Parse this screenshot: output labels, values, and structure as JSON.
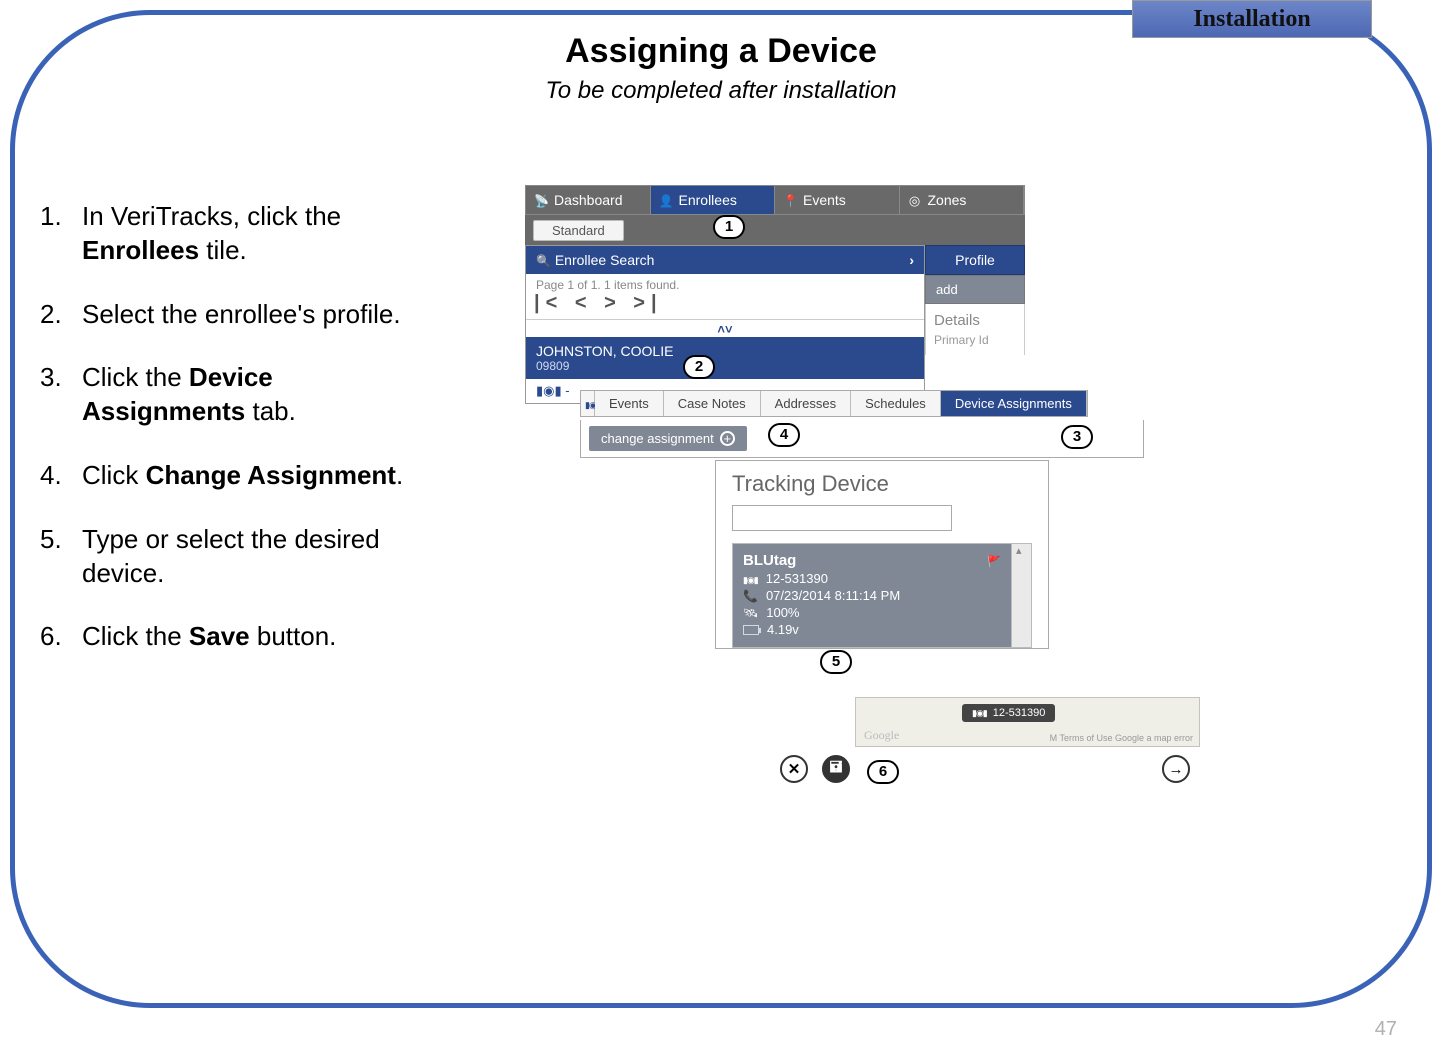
{
  "topTab": "Installation",
  "pageNumber": "47",
  "heading": "Assigning a Device",
  "subtitle": "To be completed after installation",
  "steps": {
    "s1_pre": "In VeriTracks, click the ",
    "s1_b": "Enrollees",
    "s1_post": " tile.",
    "s2": "Select the enrollee's profile.",
    "s3_pre": "Click the ",
    "s3_b": "Device Assignments",
    "s3_post": " tab.",
    "s4_pre": "Click ",
    "s4_b": "Change Assignment",
    "s4_post": ".",
    "s5": "Type or select the desired device.",
    "s6_pre": "Click the ",
    "s6_b": "Save",
    "s6_post": " button."
  },
  "callouts": {
    "c1": "1",
    "c2": "2",
    "c3": "3",
    "c4": "4",
    "c5": "5",
    "c6": "6"
  },
  "nav": {
    "dashboard": "Dashboard",
    "enrollees": "Enrollees",
    "events": "Events",
    "zones": "Zones",
    "standard": "Standard"
  },
  "search": {
    "title": "Enrollee Search",
    "pageInfo": "Page 1 of 1. 1 items found.",
    "pager": "|<  <  >  >|",
    "sort": "˄˅",
    "enrolleeName": "JOHNSTON, COOLIE",
    "enrolleeId": "09809",
    "footIcon": "▮◉▮ -"
  },
  "profile": {
    "btn": "Profile",
    "add": "add",
    "details": "Details",
    "primaryId": "Primary Id"
  },
  "tabs": {
    "events": "Events",
    "caseNotes": "Case Notes",
    "addresses": "Addresses",
    "schedules": "Schedules",
    "deviceAssignments": "Device Assignments"
  },
  "change": {
    "label": "change assignment",
    "plus": "+"
  },
  "tracking": {
    "title": "Tracking Device",
    "placeholder": "",
    "deviceName": "BLUtag",
    "deviceId": "12-531390",
    "lastCall": "07/23/2014 8:11:14 PM",
    "battery": "100%",
    "voltage": "4.19v"
  },
  "map": {
    "pill": "12-531390",
    "credit": "Google",
    "terms": "M  Terms of Use   Google a map error"
  },
  "bottomIcons": {
    "close": "✕",
    "save": "🖬",
    "next": "→"
  }
}
